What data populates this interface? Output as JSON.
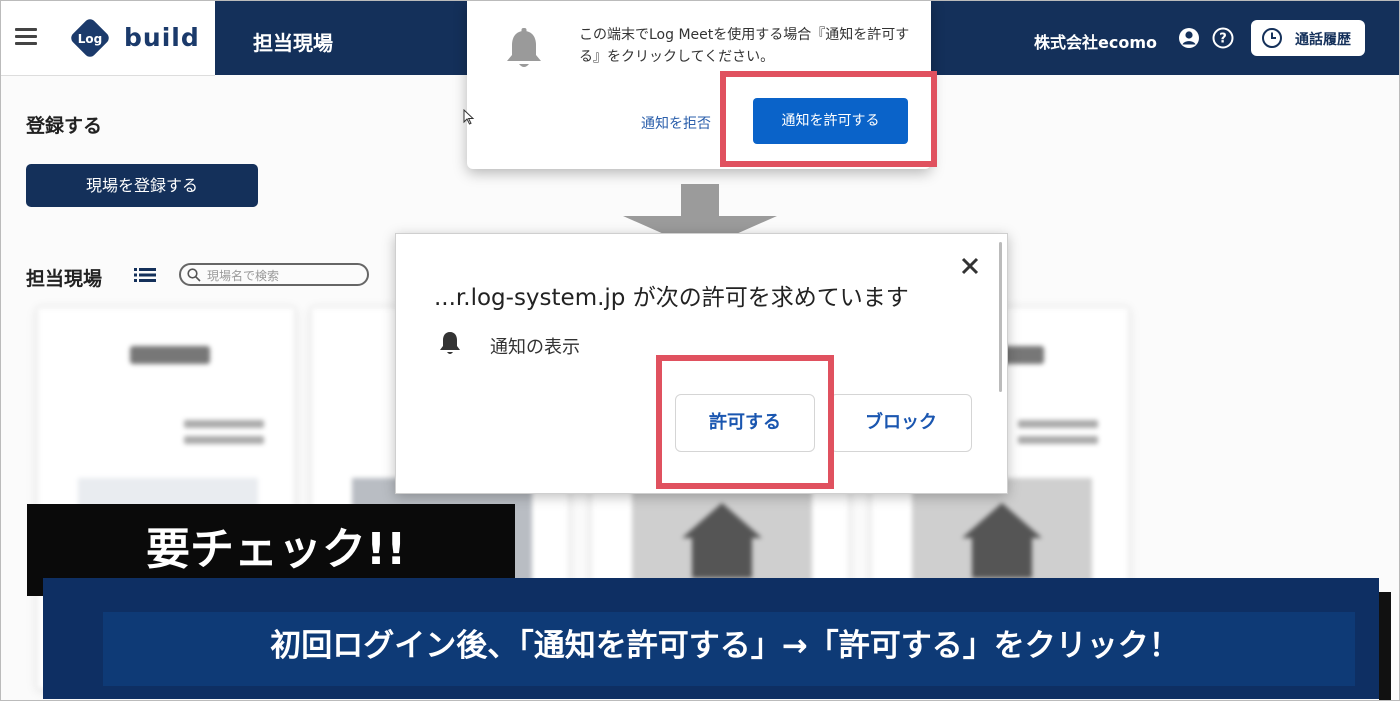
{
  "header": {
    "logo_text": "build",
    "title": "担当現場",
    "company": "株式会社ecomo",
    "history_label": "通話履歴"
  },
  "content": {
    "register_heading": "登録する",
    "register_button": "現場を登録する",
    "sites_heading": "担当現場",
    "search_placeholder": "現場名で検索"
  },
  "browser_popup": {
    "message": "この端末でLog Meetを使用する場合『通知を許可する』をクリックしてください。",
    "deny_label": "通知を拒否",
    "allow_label": "通知を許可する"
  },
  "chrome_popup": {
    "title": "...r.log-system.jp が次の許可を求めています",
    "permission": "通知の表示",
    "allow_label": "許可する",
    "block_label": "ブロック"
  },
  "captions": {
    "check": "要チェック!!",
    "instruction": "初回ログイン後、「通知を許可する」→「許可する」をクリック！"
  },
  "colors": {
    "navy": "#14305a",
    "highlight_red": "#e0515f",
    "allow_blue": "#0a63c9"
  }
}
